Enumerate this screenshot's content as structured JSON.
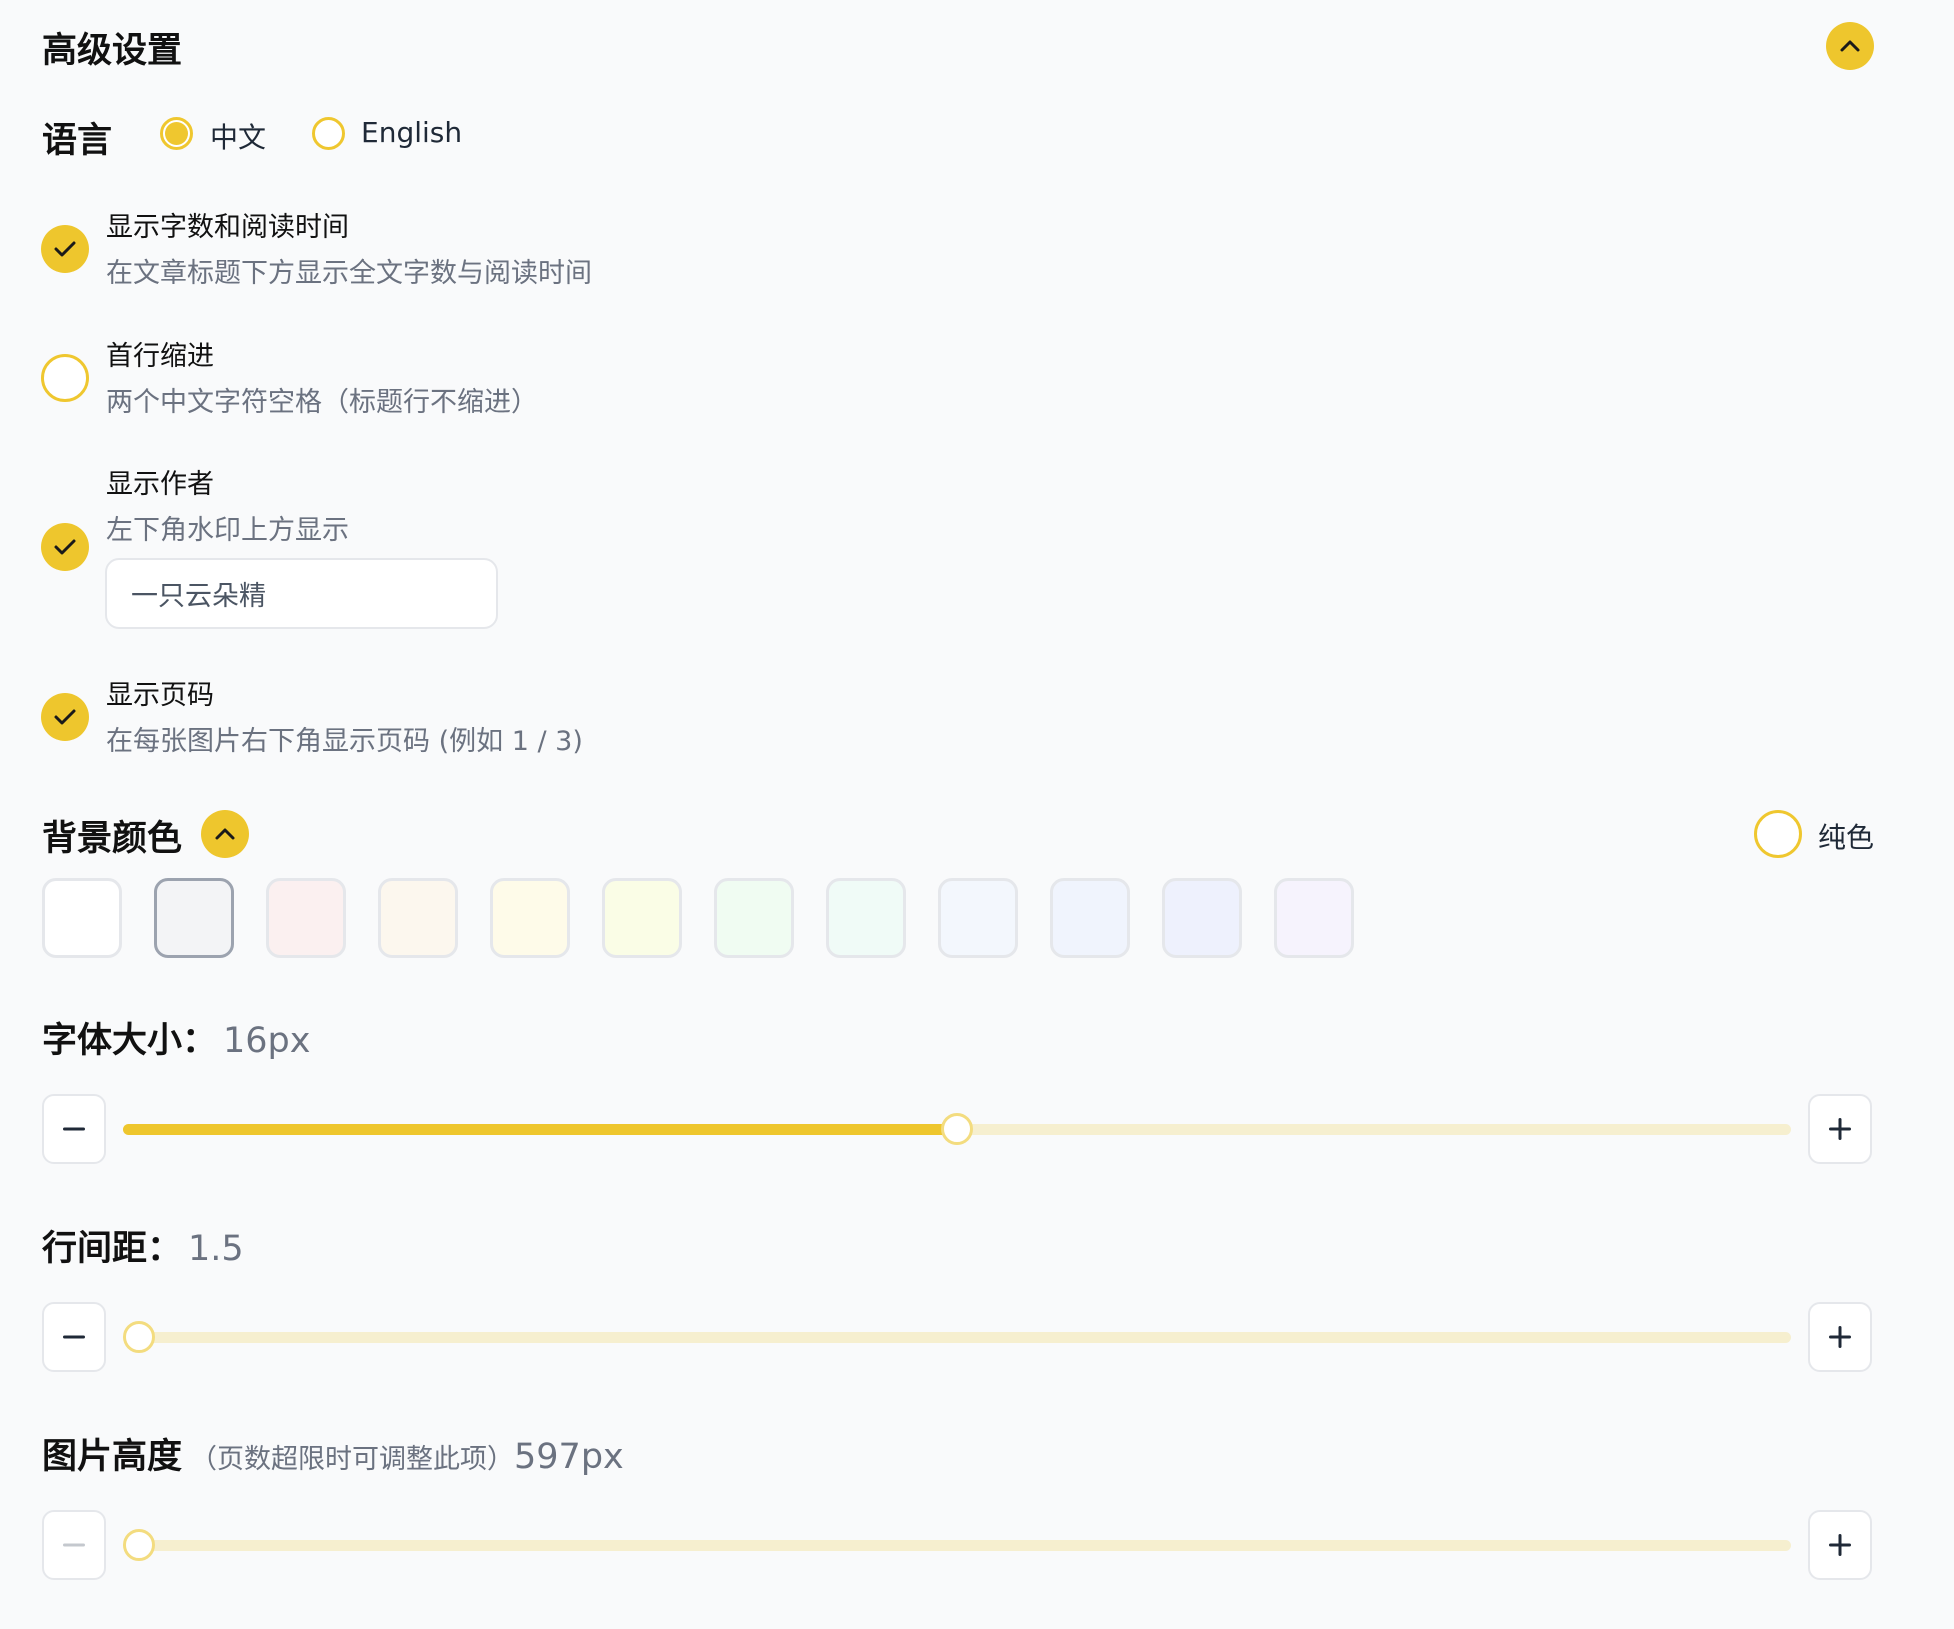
{
  "header": {
    "title": "高级设置"
  },
  "language": {
    "label": "语言",
    "options": [
      {
        "label": "中文",
        "selected": true
      },
      {
        "label": "English",
        "selected": false
      }
    ]
  },
  "options": [
    {
      "title": "显示字数和阅读时间",
      "description": "在文章标题下方显示全文字数与阅读时间",
      "checked": true
    },
    {
      "title": "首行缩进",
      "description": "两个中文字符空格（标题行不缩进）",
      "checked": false
    },
    {
      "title": "显示作者",
      "description": "左下角水印上方显示",
      "checked": true,
      "input_value": "一只云朵精"
    },
    {
      "title": "显示页码",
      "description": "在每张图片右下角显示页码 (例如 1 / 3)",
      "checked": true
    }
  ],
  "background": {
    "title": "背景颜色",
    "solid_label": "纯色",
    "solid_checked": false,
    "swatches": [
      "#ffffff",
      "#f3f4f6",
      "#fbf0f0",
      "#fcf7ee",
      "#fefbe9",
      "#fafde6",
      "#f0fcf2",
      "#f0fbf7",
      "#f3f7fd",
      "#f0f4fd",
      "#eef1fd",
      "#f6f3fd"
    ],
    "selected_index": 1
  },
  "font_size": {
    "label": "字体大小：",
    "value": "16px",
    "fraction": 0.5
  },
  "line_height": {
    "label": "行间距：",
    "value": "1.5",
    "fraction": 0.0
  },
  "image_height": {
    "label": "图片高度",
    "note": "（页数超限时可调整此项）",
    "value": "597px",
    "fraction": 0.0
  }
}
